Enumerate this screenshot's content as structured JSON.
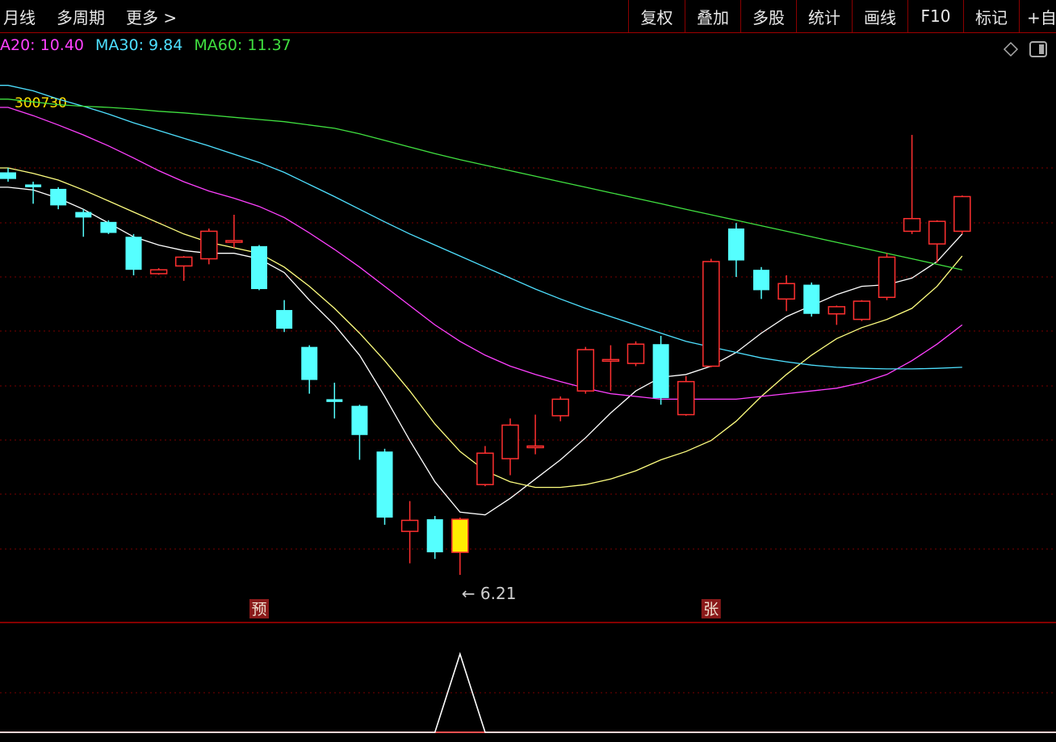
{
  "toolbar": {
    "left": [
      "月线",
      "多周期",
      "更多 >"
    ],
    "right": [
      "复权",
      "叠加",
      "多股",
      "统计",
      "画线",
      "F10",
      "标记",
      "+自"
    ]
  },
  "ma_legend": [
    {
      "label": "A20: 10.40",
      "color": "#ff40ff"
    },
    {
      "label": "MA30: 9.84",
      "color": "#4ee0ff"
    },
    {
      "label": "MA60: 11.37",
      "color": "#40e040"
    }
  ],
  "stock_code": "300730",
  "icons": [
    "diamond-icon",
    "panel-toggle-icon"
  ],
  "chart_data": {
    "type": "candlestick",
    "period": "monthly",
    "colors": {
      "up": "#ff3030",
      "down": "#55ffff",
      "ma5": "#ffffff",
      "ma10": "#ffff80",
      "ma20": "#ff40ff",
      "ma30": "#4ee0ff",
      "ma60": "#40e040"
    },
    "candles": [
      {
        "o": 13.52,
        "c": 13.4,
        "h": 13.6,
        "l": 13.35
      },
      {
        "o": 13.3,
        "c": 13.25,
        "h": 13.35,
        "l": 12.95
      },
      {
        "o": 13.22,
        "c": 12.92,
        "h": 13.25,
        "l": 12.85
      },
      {
        "o": 12.8,
        "c": 12.7,
        "h": 12.85,
        "l": 12.35
      },
      {
        "o": 12.62,
        "c": 12.42,
        "h": 12.65,
        "l": 12.4
      },
      {
        "o": 12.35,
        "c": 11.75,
        "h": 12.4,
        "l": 11.65
      },
      {
        "o": 11.68,
        "c": 11.75,
        "h": 11.78,
        "l": 11.66
      },
      {
        "o": 11.82,
        "c": 11.98,
        "h": 12.0,
        "l": 11.55
      },
      {
        "o": 11.95,
        "c": 12.45,
        "h": 12.5,
        "l": 11.85
      },
      {
        "o": 12.25,
        "c": 12.28,
        "h": 12.75,
        "l": 12.15
      },
      {
        "o": 12.18,
        "c": 11.4,
        "h": 12.2,
        "l": 11.38
      },
      {
        "o": 11.02,
        "c": 10.68,
        "h": 11.2,
        "l": 10.62
      },
      {
        "o": 10.35,
        "c": 9.75,
        "h": 10.38,
        "l": 9.5
      },
      {
        "o": 9.4,
        "c": 9.35,
        "h": 9.7,
        "l": 9.05
      },
      {
        "o": 9.28,
        "c": 8.75,
        "h": 9.3,
        "l": 8.3
      },
      {
        "o": 8.45,
        "c": 7.25,
        "h": 8.5,
        "l": 7.12
      },
      {
        "o": 7.0,
        "c": 7.2,
        "h": 7.55,
        "l": 6.42
      },
      {
        "o": 7.22,
        "c": 6.62,
        "h": 7.28,
        "l": 6.5
      },
      {
        "o": 7.22,
        "c": 6.62,
        "h": 7.25,
        "l": 6.21
      },
      {
        "o": 7.85,
        "c": 8.42,
        "h": 8.55,
        "l": 7.82
      },
      {
        "o": 8.32,
        "c": 8.93,
        "h": 9.05,
        "l": 8.02
      },
      {
        "o": 8.53,
        "c": 8.55,
        "h": 9.12,
        "l": 8.4
      },
      {
        "o": 9.1,
        "c": 9.4,
        "h": 9.45,
        "l": 9.0
      },
      {
        "o": 9.55,
        "c": 10.3,
        "h": 10.35,
        "l": 9.5
      },
      {
        "o": 10.1,
        "c": 10.12,
        "h": 10.38,
        "l": 9.55
      },
      {
        "o": 10.05,
        "c": 10.4,
        "h": 10.45,
        "l": 10.0
      },
      {
        "o": 10.4,
        "c": 9.42,
        "h": 10.55,
        "l": 9.3
      },
      {
        "o": 9.12,
        "c": 9.72,
        "h": 9.82,
        "l": 9.1
      },
      {
        "o": 10.0,
        "c": 11.9,
        "h": 11.95,
        "l": 9.98
      },
      {
        "o": 12.5,
        "c": 11.92,
        "h": 12.6,
        "l": 11.62
      },
      {
        "o": 11.75,
        "c": 11.38,
        "h": 11.8,
        "l": 11.22
      },
      {
        "o": 11.22,
        "c": 11.5,
        "h": 11.65,
        "l": 11.0
      },
      {
        "o": 11.48,
        "c": 10.95,
        "h": 11.52,
        "l": 10.9
      },
      {
        "o": 10.95,
        "c": 11.08,
        "h": 11.1,
        "l": 10.75
      },
      {
        "o": 10.85,
        "c": 11.18,
        "h": 11.2,
        "l": 10.82
      },
      {
        "o": 11.25,
        "c": 11.98,
        "h": 12.05,
        "l": 11.2
      },
      {
        "o": 12.45,
        "c": 12.68,
        "h": 14.2,
        "l": 12.4
      },
      {
        "o": 12.22,
        "c": 12.63,
        "h": 12.65,
        "l": 11.88
      },
      {
        "o": 12.45,
        "c": 13.08,
        "h": 13.1,
        "l": 12.4
      }
    ],
    "ma": [
      {
        "name": "MA5",
        "values": [
          13.25,
          13.2,
          13.05,
          12.85,
          12.6,
          12.35,
          12.2,
          12.1,
          12.05,
          12.05,
          11.95,
          11.7,
          11.2,
          10.75,
          10.2,
          9.45,
          8.65,
          7.9,
          7.35,
          7.3,
          7.6,
          7.95,
          8.3,
          8.7,
          9.15,
          9.55,
          9.8,
          9.85,
          10.0,
          10.25,
          10.6,
          10.9,
          11.1,
          11.3,
          11.45,
          11.48,
          11.6,
          11.9,
          12.4
        ]
      },
      {
        "name": "MA10",
        "values": [
          13.6,
          13.5,
          13.38,
          13.2,
          13.0,
          12.8,
          12.6,
          12.4,
          12.25,
          12.15,
          12.05,
          11.8,
          11.45,
          11.05,
          10.6,
          10.1,
          9.55,
          8.95,
          8.45,
          8.1,
          7.9,
          7.8,
          7.8,
          7.85,
          7.95,
          8.1,
          8.3,
          8.45,
          8.65,
          9.0,
          9.45,
          9.85,
          10.2,
          10.5,
          10.7,
          10.85,
          11.05,
          11.45,
          12.0
        ]
      },
      {
        "name": "MA20",
        "values": [
          14.7,
          14.55,
          14.38,
          14.2,
          14.0,
          13.78,
          13.55,
          13.35,
          13.18,
          13.05,
          12.9,
          12.7,
          12.42,
          12.12,
          11.8,
          11.45,
          11.1,
          10.75,
          10.45,
          10.2,
          10.0,
          9.85,
          9.72,
          9.6,
          9.5,
          9.45,
          9.4,
          9.4,
          9.4,
          9.4,
          9.45,
          9.5,
          9.55,
          9.6,
          9.7,
          9.85,
          10.1,
          10.4,
          10.75
        ]
      },
      {
        "name": "MA30",
        "values": [
          15.1,
          15.0,
          14.85,
          14.72,
          14.58,
          14.42,
          14.28,
          14.14,
          14.0,
          13.85,
          13.7,
          13.52,
          13.3,
          13.08,
          12.85,
          12.62,
          12.4,
          12.2,
          12.0,
          11.8,
          11.6,
          11.4,
          11.22,
          11.05,
          10.9,
          10.75,
          10.6,
          10.45,
          10.35,
          10.25,
          10.15,
          10.08,
          10.02,
          9.98,
          9.96,
          9.95,
          9.95,
          9.96,
          9.98
        ]
      },
      {
        "name": "MA60",
        "values": [
          14.85,
          14.8,
          14.75,
          14.72,
          14.7,
          14.67,
          14.63,
          14.6,
          14.56,
          14.52,
          14.48,
          14.44,
          14.38,
          14.32,
          14.22,
          14.1,
          13.98,
          13.86,
          13.75,
          13.65,
          13.55,
          13.45,
          13.35,
          13.25,
          13.15,
          13.05,
          12.95,
          12.85,
          12.75,
          12.65,
          12.55,
          12.45,
          12.35,
          12.25,
          12.15,
          12.05,
          11.95,
          11.85,
          11.75
        ]
      }
    ],
    "annotations": [
      {
        "type": "low-label",
        "text": "← 6.21",
        "candle": 18
      },
      {
        "type": "marker",
        "text": "预",
        "candle": 10
      },
      {
        "type": "marker",
        "text": "张",
        "candle": 28
      }
    ],
    "highlight_candle": {
      "index": 18,
      "color": "#ffee00"
    },
    "indicator": {
      "type": "line",
      "color": "#ffffff",
      "values": [
        0,
        0,
        0,
        0,
        0,
        0,
        0,
        0,
        0,
        0,
        0,
        0,
        0,
        0,
        0,
        0,
        0,
        0,
        1,
        0,
        0,
        0,
        0,
        0,
        0,
        0,
        0,
        0,
        0,
        0,
        0,
        0,
        0,
        0,
        0,
        0,
        0,
        0,
        0
      ],
      "baseline_color": "#ff5050"
    }
  }
}
